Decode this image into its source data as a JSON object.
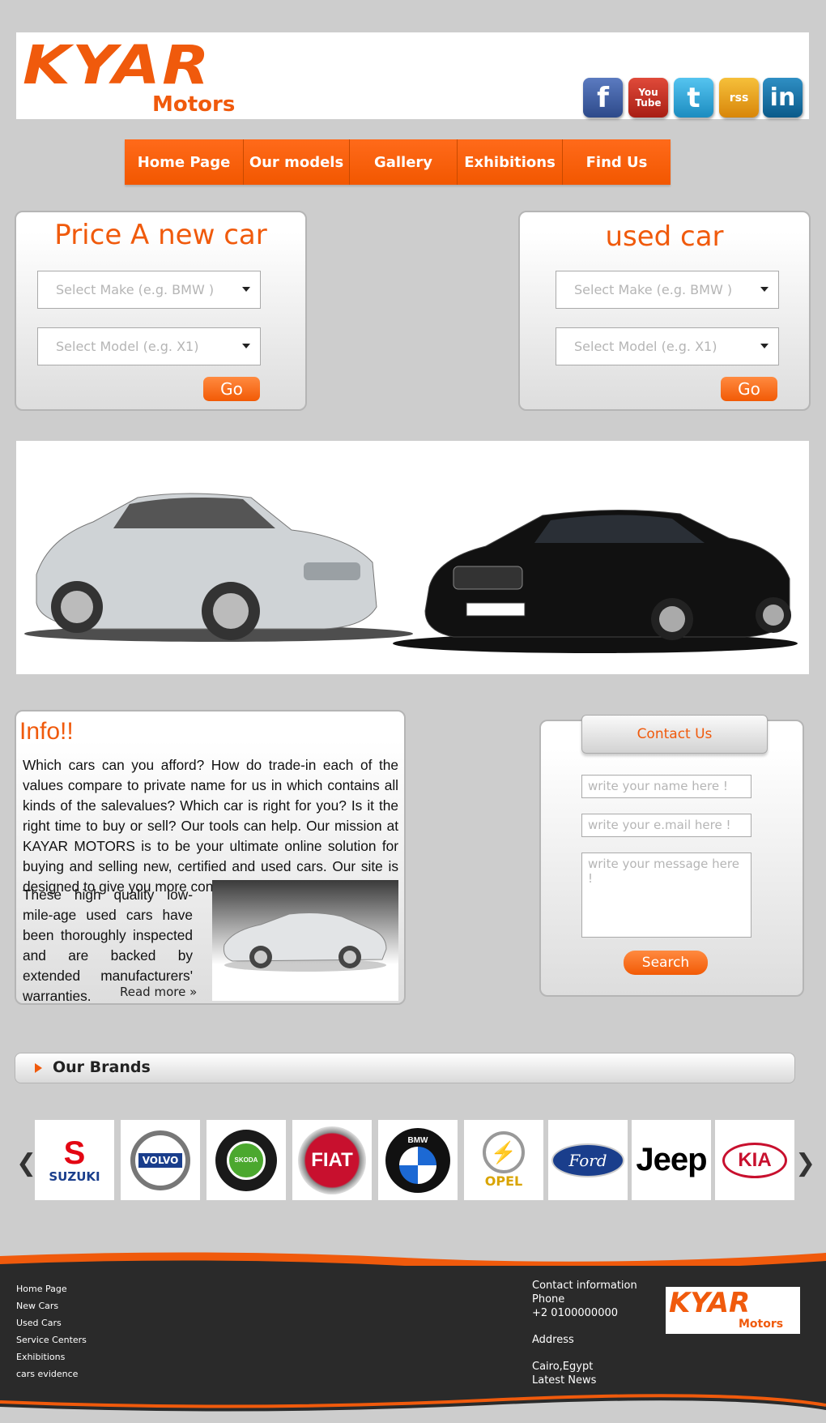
{
  "header": {
    "logo_main": "KYAR",
    "logo_sub": "Motors",
    "social": [
      {
        "icon": "facebook-icon",
        "label": "f",
        "color": "#3b5998"
      },
      {
        "icon": "youtube-icon",
        "label": "You Tube",
        "color": "#c4302b"
      },
      {
        "icon": "twitter-icon",
        "label": "t",
        "color": "#29a9e1"
      },
      {
        "icon": "rss-icon",
        "label": "rss",
        "color": "#f2a30f"
      },
      {
        "icon": "linkedin-icon",
        "label": "in",
        "color": "#0e76a8"
      }
    ]
  },
  "nav": [
    "Home Page",
    "Our models",
    "Gallery",
    "Exhibitions",
    "Find Us"
  ],
  "new_car": {
    "title": "Price A new car",
    "make_placeholder": "Select Make (e.g. BMW )",
    "model_placeholder": "Select Model (e.g. X1)",
    "go": "Go"
  },
  "used_car": {
    "title": "used car",
    "make_placeholder": "Select Make (e.g. BMW )",
    "model_placeholder": "Select Model (e.g. X1)",
    "go": "Go"
  },
  "info": {
    "title": "Info!!",
    "paragraph1": "Which cars can you afford? How do trade-in each of the values compare to private name for us in which contains all kinds of the salevalues? Which car is right for you? Is it the right time to buy or sell? Our tools can help. Our mission at KAYAR MOTORS is to be your ultimate online solution for buying and selling new, certified and used cars. Our site is designed to give you more control of the",
    "paragraph2": "These high quality low-mile-age used cars have been thoroughly inspected and are backed by extended manufacturers' warranties.",
    "read_more": "Read more »"
  },
  "contact": {
    "title": "Contact Us",
    "name_placeholder": "write your name here !",
    "email_placeholder": "write your e.mail here !",
    "message_placeholder": "write your message here !",
    "submit": "Search"
  },
  "brands": {
    "title": "Our Brands",
    "items": [
      "SUZUKI",
      "VOLVO",
      "SKODA",
      "FIAT",
      "BMW",
      "OPEL",
      "Ford",
      "Jeep",
      "KIA"
    ],
    "prev": "❮",
    "next": "❯"
  },
  "footer": {
    "links": [
      "Home Page",
      "New Cars",
      "Used Cars",
      "Service Centers",
      "Exhibitions",
      "cars evidence"
    ],
    "contact_title": "Contact information",
    "phone_label": "Phone",
    "phone": "+2 0100000000",
    "address_label": "Address",
    "address": "Cairo,Egypt",
    "latest_news": "Latest News",
    "logo_main": "KYAR",
    "logo_sub": "Motors"
  },
  "colors": {
    "accent": "#f05a0c",
    "background": "#cdcdcd",
    "footer": "#2a2a2a"
  }
}
